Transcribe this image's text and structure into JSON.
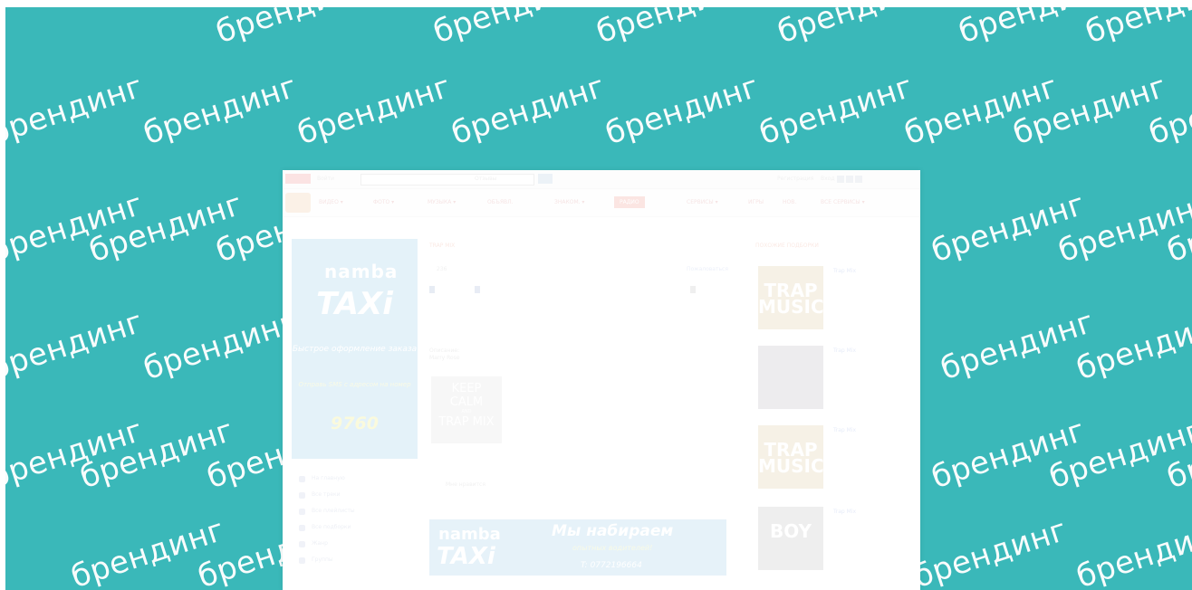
{
  "background": {
    "color": "#3ab8b9",
    "watermark_text": "брендинг"
  },
  "site": {
    "topbar": {
      "logo_label": "",
      "link1": "Войти",
      "search_select": "Отзывы",
      "right_link1": "Регистрация",
      "right_link2": "Вход"
    },
    "nav": [
      "ВИДЕО ▾",
      "ФОТО ▾",
      "МУЗЫКА ▾",
      "ОБЪЯВЛ.",
      "ЗНАКОМ. ▾",
      "РАДИО",
      "СЕРВИСЫ ▾",
      "ИГРЫ",
      "НОВ.",
      "ВСЕ СЕРВИСЫ ▾"
    ],
    "left_ad": {
      "logo": "namba",
      "title": "TAXi",
      "line1": "Быстрое оформление заказа",
      "line2": "Отправь SMS с адресом на номер",
      "number": "9760"
    },
    "side_menu": [
      "На главную",
      "Все треки",
      "Все плейлисты",
      "Все подборки",
      "Жанр",
      "Группы"
    ],
    "center": {
      "title": "TRAP MIX",
      "count": "236",
      "complain": "Пожаловаться",
      "description_label": "Описание:",
      "description_text": "Marry Rose",
      "keep_calm": [
        "KEEP",
        "CALM",
        "AND",
        "TRAP MIX"
      ],
      "likes_label": "Мне нравится",
      "banner": {
        "logo": "namba",
        "taxi": "TAXi",
        "headline": "Мы набираем",
        "sub": "опытных водителей!",
        "phone": "T: 0772196664"
      }
    },
    "right": {
      "title": "ПОХОЖИЕ ПОДБОРКИ",
      "items": [
        {
          "title": "Trap Mix",
          "thumb": "TRAP MUSIC"
        },
        {
          "title": "Trap Mix",
          "thumb": ""
        },
        {
          "title": "Trap Mix",
          "thumb": "TRAP MUSIC"
        },
        {
          "title": "Trap Mix",
          "thumb": "BOY"
        }
      ]
    }
  }
}
